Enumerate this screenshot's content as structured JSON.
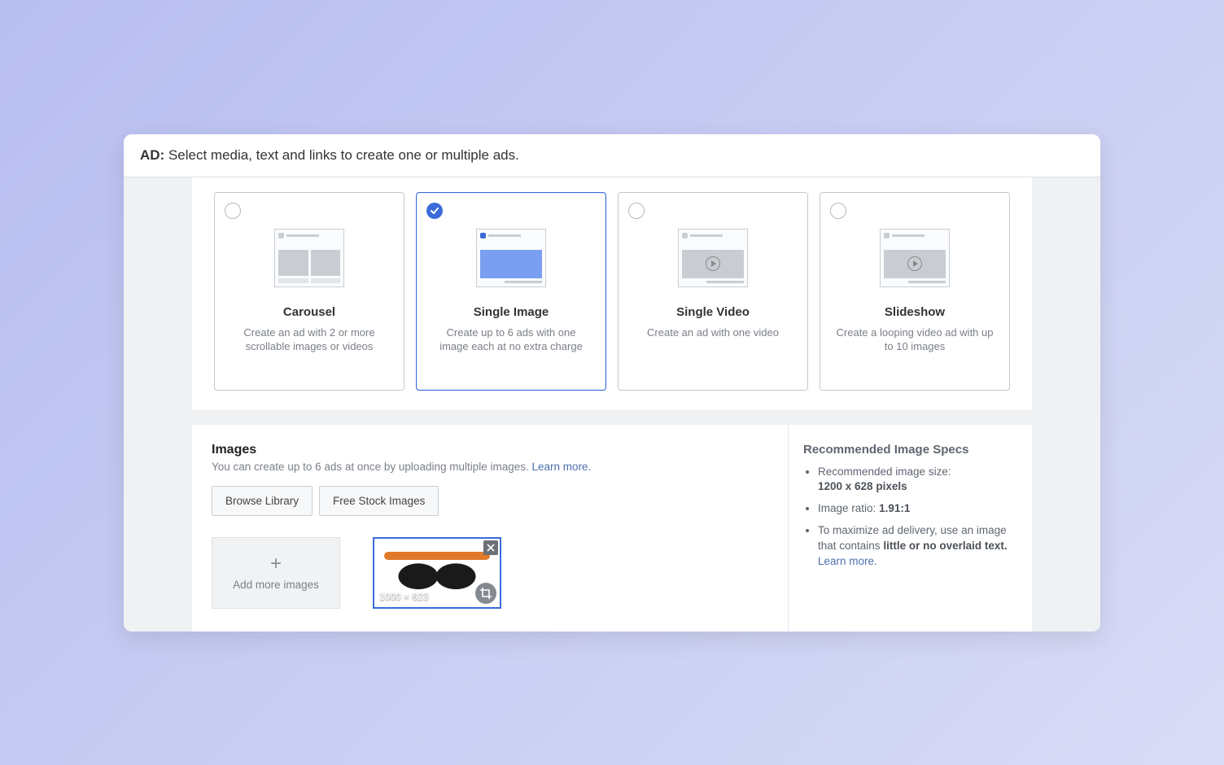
{
  "header": {
    "prefix": "AD:",
    "text": "Select media, text and links to create one or multiple ads."
  },
  "formats": [
    {
      "title": "Carousel",
      "desc": "Create an ad with 2 or more scrollable images or videos",
      "selected": false
    },
    {
      "title": "Single Image",
      "desc": "Create up to 6 ads with one image each at no extra charge",
      "selected": true
    },
    {
      "title": "Single Video",
      "desc": "Create an ad with one video",
      "selected": false
    },
    {
      "title": "Slideshow",
      "desc": "Create a looping video ad with up to 10 images",
      "selected": false
    }
  ],
  "images": {
    "title": "Images",
    "subtitle": "You can create up to 6 ads at once by uploading multiple images.",
    "learn_more": "Learn more.",
    "browse_library": "Browse Library",
    "free_stock": "Free Stock Images",
    "add_more": "Add more images",
    "uploaded_dim": "1000 × 623"
  },
  "specs": {
    "heading": "Recommended Image Specs",
    "size_label": "Recommended image size:",
    "size_value": "1200 x 628 pixels",
    "ratio_label": "Image ratio:",
    "ratio_value": "1.91:1",
    "text_advice_pre": "To maximize ad delivery, use an image that contains",
    "text_advice_bold": "little or no overlaid text.",
    "learn_more": "Learn more."
  }
}
